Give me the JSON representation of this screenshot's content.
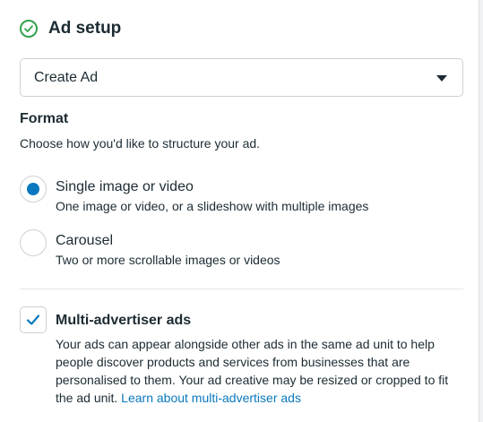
{
  "header": {
    "title": "Ad setup",
    "status_icon": "check-circle-icon",
    "status_color": "#31a24c"
  },
  "ad_select": {
    "value": "Create Ad"
  },
  "format": {
    "title": "Format",
    "description": "Choose how you'd like to structure your ad.",
    "options": [
      {
        "label": "Single image or video",
        "description": "One image or video, or a slideshow with multiple images",
        "selected": true
      },
      {
        "label": "Carousel",
        "description": "Two or more scrollable images or videos",
        "selected": false
      }
    ]
  },
  "multi_advertiser": {
    "label": "Multi-advertiser ads",
    "checked": true,
    "description": "Your ads can appear alongside other ads in the same ad unit to help people discover products and services from businesses that are personalised to them. Your ad creative may be resized or cropped to fit the ad unit.",
    "link_text": "Learn about multi-advertiser ads"
  },
  "colors": {
    "accent": "#0a78be",
    "text": "#1c2b33",
    "border": "#ced0d4"
  }
}
